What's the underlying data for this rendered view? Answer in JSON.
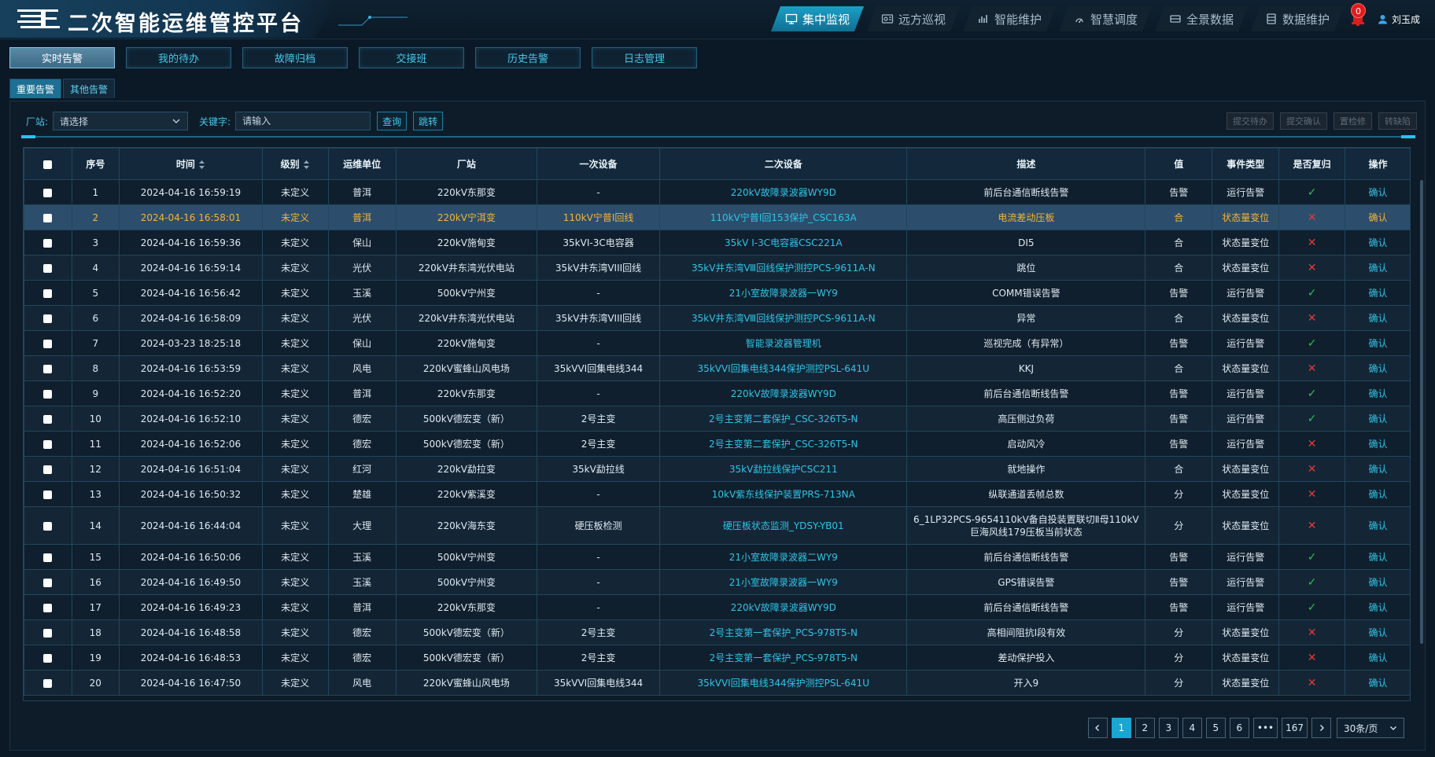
{
  "app": {
    "title": "二次智能运维管控平台"
  },
  "topnav": [
    {
      "label": "集中监视",
      "icon": "monitor-icon",
      "active": true
    },
    {
      "label": "远方巡视",
      "icon": "patrol-icon",
      "active": false
    },
    {
      "label": "智能维护",
      "icon": "maintenance-icon",
      "active": false
    },
    {
      "label": "智慧调度",
      "icon": "dispatch-icon",
      "active": false
    },
    {
      "label": "全景数据",
      "icon": "data-icon",
      "active": false
    },
    {
      "label": "数据维护",
      "icon": "database-icon",
      "active": false
    }
  ],
  "notifications": {
    "count": "0"
  },
  "user": {
    "name": "刘玉成"
  },
  "subtabs": [
    {
      "label": "实时告警",
      "active": true
    },
    {
      "label": "我的待办",
      "active": false
    },
    {
      "label": "故障归档",
      "active": false
    },
    {
      "label": "交接班",
      "active": false
    },
    {
      "label": "历史告警",
      "active": false
    },
    {
      "label": "日志管理",
      "active": false
    }
  ],
  "alarm_tabs": [
    {
      "label": "重要告警",
      "active": true
    },
    {
      "label": "其他告警",
      "active": false
    }
  ],
  "filters": {
    "station_label": "厂站:",
    "station_value": "请选择",
    "keyword_label": "关键字:",
    "keyword_placeholder": "请输入",
    "query": "查询",
    "jump": "跳转"
  },
  "actions": [
    "提交待办",
    "提交确认",
    "置检修",
    "转缺陷"
  ],
  "table": {
    "headers": [
      "",
      "序号",
      "时间",
      "级别",
      "运维单位",
      "厂站",
      "一次设备",
      "二次设备",
      "描述",
      "值",
      "事件类型",
      "是否复归",
      "操作"
    ],
    "rows": [
      {
        "no": "1",
        "time": "2024-04-16 16:59:19",
        "level": "未定义",
        "unit": "普洱",
        "station": "220kV东那变",
        "primary": "-",
        "secondary": "220kV故障录波器WY9D",
        "desc": "前后台通信断线告警",
        "value": "告警",
        "type": "运行告警",
        "reset": true,
        "op": "确认"
      },
      {
        "no": "2",
        "time": "2024-04-16 16:58:01",
        "level": "未定义",
        "unit": "普洱",
        "station": "220kV宁洱变",
        "primary": "110kV宁普Ⅰ回线",
        "secondary": "110kV宁普Ⅰ回153保护_CSC163A",
        "desc": "电流差动压板",
        "value": "合",
        "type": "状态量变位",
        "reset": false,
        "op": "确认",
        "selected": true
      },
      {
        "no": "3",
        "time": "2024-04-16 16:59:36",
        "level": "未定义",
        "unit": "保山",
        "station": "220kV施甸变",
        "primary": "35kVⅠ-3C电容器",
        "secondary": "35kV Ⅰ-3C电容器CSC221A",
        "desc": "DI5",
        "value": "合",
        "type": "状态量变位",
        "reset": false,
        "op": "确认"
      },
      {
        "no": "4",
        "time": "2024-04-16 16:59:14",
        "level": "未定义",
        "unit": "光伏",
        "station": "220kV井东湾光伏电站",
        "primary": "35kV井东湾VIII回线",
        "secondary": "35kV井东湾Ⅷ回线保护测控PCS-9611A-N",
        "desc": "跳位",
        "value": "合",
        "type": "状态量变位",
        "reset": false,
        "op": "确认"
      },
      {
        "no": "5",
        "time": "2024-04-16 16:56:42",
        "level": "未定义",
        "unit": "玉溪",
        "station": "500kV宁州变",
        "primary": "-",
        "secondary": "21小室故障录波器一WY9",
        "desc": "COMM错误告警",
        "value": "告警",
        "type": "运行告警",
        "reset": true,
        "op": "确认"
      },
      {
        "no": "6",
        "time": "2024-04-16 16:58:09",
        "level": "未定义",
        "unit": "光伏",
        "station": "220kV井东湾光伏电站",
        "primary": "35kV井东湾VIII回线",
        "secondary": "35kV井东湾Ⅷ回线保护测控PCS-9611A-N",
        "desc": "异常",
        "value": "合",
        "type": "状态量变位",
        "reset": false,
        "op": "确认"
      },
      {
        "no": "7",
        "time": "2024-03-23 18:25:18",
        "level": "未定义",
        "unit": "保山",
        "station": "220kV施甸变",
        "primary": "-",
        "secondary": "智能录波器管理机",
        "desc": "巡视完成（有异常）",
        "value": "告警",
        "type": "运行告警",
        "reset": true,
        "op": "确认"
      },
      {
        "no": "8",
        "time": "2024-04-16 16:53:59",
        "level": "未定义",
        "unit": "风电",
        "station": "220kV蜜蜂山风电场",
        "primary": "35kVVI回集电线344",
        "secondary": "35kVVI回集电线344保护测控PSL-641U",
        "desc": "KKJ",
        "value": "合",
        "type": "状态量变位",
        "reset": false,
        "op": "确认"
      },
      {
        "no": "9",
        "time": "2024-04-16 16:52:20",
        "level": "未定义",
        "unit": "普洱",
        "station": "220kV东那变",
        "primary": "-",
        "secondary": "220kV故障录波器WY9D",
        "desc": "前后台通信断线告警",
        "value": "告警",
        "type": "运行告警",
        "reset": true,
        "op": "确认"
      },
      {
        "no": "10",
        "time": "2024-04-16 16:52:10",
        "level": "未定义",
        "unit": "德宏",
        "station": "500kV德宏变（新）",
        "primary": "2号主变",
        "secondary": "2号主变第二套保护_CSC-326T5-N",
        "desc": "高压侧过负荷",
        "value": "告警",
        "type": "运行告警",
        "reset": true,
        "op": "确认"
      },
      {
        "no": "11",
        "time": "2024-04-16 16:52:06",
        "level": "未定义",
        "unit": "德宏",
        "station": "500kV德宏变（新）",
        "primary": "2号主变",
        "secondary": "2号主变第二套保护_CSC-326T5-N",
        "desc": "启动风冷",
        "value": "告警",
        "type": "运行告警",
        "reset": false,
        "op": "确认"
      },
      {
        "no": "12",
        "time": "2024-04-16 16:51:04",
        "level": "未定义",
        "unit": "红河",
        "station": "220kV勐拉变",
        "primary": "35kV勐拉线",
        "secondary": "35kV勐拉线保护CSC211",
        "desc": "就地操作",
        "value": "合",
        "type": "状态量变位",
        "reset": false,
        "op": "确认"
      },
      {
        "no": "13",
        "time": "2024-04-16 16:50:32",
        "level": "未定义",
        "unit": "楚雄",
        "station": "220kV紫溪变",
        "primary": "-",
        "secondary": "10kV紫东线保护装置PRS-713NA",
        "desc": "纵联通道丢帧总数",
        "value": "分",
        "type": "状态量变位",
        "reset": false,
        "op": "确认"
      },
      {
        "no": "14",
        "time": "2024-04-16 16:44:04",
        "level": "未定义",
        "unit": "大理",
        "station": "220kV海东变",
        "primary": "硬压板检测",
        "secondary": "硬压板状态监测_YDSY-YB01",
        "desc": "6_1LP32PCS-9654110kV备自投装置联切Ⅱ母110kV巨海风线179压板当前状态",
        "value": "分",
        "type": "状态量变位",
        "reset": false,
        "op": "确认",
        "tall": true
      },
      {
        "no": "15",
        "time": "2024-04-16 16:50:06",
        "level": "未定义",
        "unit": "玉溪",
        "station": "500kV宁州变",
        "primary": "-",
        "secondary": "21小室故障录波器二WY9",
        "desc": "前后台通信断线告警",
        "value": "告警",
        "type": "运行告警",
        "reset": true,
        "op": "确认"
      },
      {
        "no": "16",
        "time": "2024-04-16 16:49:50",
        "level": "未定义",
        "unit": "玉溪",
        "station": "500kV宁州变",
        "primary": "-",
        "secondary": "21小室故障录波器一WY9",
        "desc": "GPS错误告警",
        "value": "告警",
        "type": "运行告警",
        "reset": true,
        "op": "确认"
      },
      {
        "no": "17",
        "time": "2024-04-16 16:49:23",
        "level": "未定义",
        "unit": "普洱",
        "station": "220kV东那变",
        "primary": "-",
        "secondary": "220kV故障录波器WY9D",
        "desc": "前后台通信断线告警",
        "value": "告警",
        "type": "运行告警",
        "reset": true,
        "op": "确认"
      },
      {
        "no": "18",
        "time": "2024-04-16 16:48:58",
        "level": "未定义",
        "unit": "德宏",
        "station": "500kV德宏变（新）",
        "primary": "2号主变",
        "secondary": "2号主变第一套保护_PCS-978T5-N",
        "desc": "高相间阻抗Ⅰ段有效",
        "value": "分",
        "type": "状态量变位",
        "reset": false,
        "op": "确认"
      },
      {
        "no": "19",
        "time": "2024-04-16 16:48:53",
        "level": "未定义",
        "unit": "德宏",
        "station": "500kV德宏变（新）",
        "primary": "2号主变",
        "secondary": "2号主变第一套保护_PCS-978T5-N",
        "desc": "差动保护投入",
        "value": "分",
        "type": "状态量变位",
        "reset": false,
        "op": "确认"
      },
      {
        "no": "20",
        "time": "2024-04-16 16:47:50",
        "level": "未定义",
        "unit": "风电",
        "station": "220kV蜜蜂山风电场",
        "primary": "35kVVI回集电线344",
        "secondary": "35kVVI回集电线344保护测控PSL-641U",
        "desc": "开入9",
        "value": "分",
        "type": "状态量变位",
        "reset": false,
        "op": "确认"
      }
    ]
  },
  "pagination": {
    "pages": [
      "1",
      "2",
      "3",
      "4",
      "5",
      "6"
    ],
    "current": "1",
    "ellipsis": "•••",
    "last": "167",
    "page_size": "30条/页"
  }
}
